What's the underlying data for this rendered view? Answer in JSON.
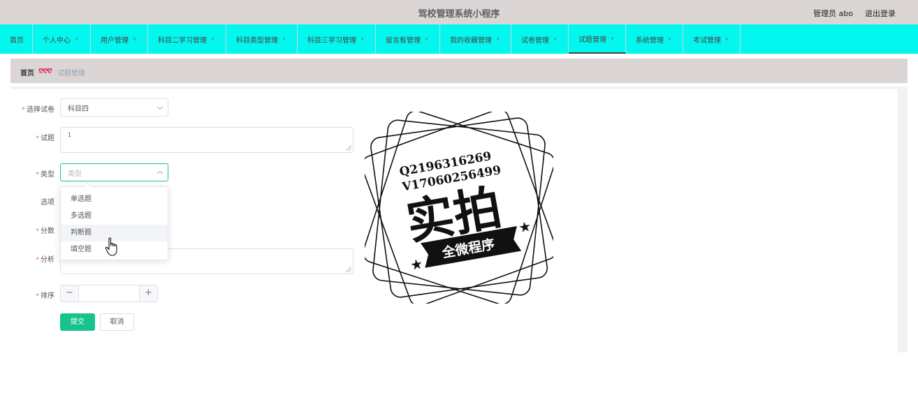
{
  "header": {
    "title": "驾校管理系统小程序",
    "user_label": "管理员 abo",
    "logout_label": "退出登录"
  },
  "nav": {
    "items": [
      {
        "label": "首页"
      },
      {
        "label": "个人中心"
      },
      {
        "label": "用户管理"
      },
      {
        "label": "科目二学习管理"
      },
      {
        "label": "科目类型管理"
      },
      {
        "label": "科目三学习管理"
      },
      {
        "label": "留言板管理"
      },
      {
        "label": "我的收藏管理"
      },
      {
        "label": "试卷管理"
      },
      {
        "label": "试题管理"
      },
      {
        "label": "系统管理"
      },
      {
        "label": "考试管理"
      }
    ],
    "active_label": "试题管理"
  },
  "breadcrumb": {
    "home": "首页",
    "separator": "ღღღ",
    "current": "试题管理"
  },
  "form": {
    "paper": {
      "label": "选择试卷",
      "value": "科目四"
    },
    "question": {
      "label": "试题",
      "value": "1"
    },
    "type": {
      "label": "类型",
      "placeholder": "类型"
    },
    "options": {
      "label": "选项"
    },
    "score": {
      "label": "分数"
    },
    "analysis": {
      "label": "分析"
    },
    "order": {
      "label": "排序",
      "minus": "−",
      "plus": "+"
    },
    "required_mark": "*",
    "submit_label": "提交",
    "cancel_label": "取消"
  },
  "type_dropdown": {
    "options": [
      "单选题",
      "多选题",
      "判断题",
      "填空题"
    ],
    "hovered": "判断题"
  },
  "watermark": {
    "line1": "Q2196316269",
    "line2": "V17060256499",
    "main": "实拍",
    "banner": "全微程序"
  },
  "colors": {
    "header_bg": "#dcd5d5",
    "nav_bg": "#04f7ee",
    "accent": "#16c38d",
    "required": "#f56c6c"
  }
}
